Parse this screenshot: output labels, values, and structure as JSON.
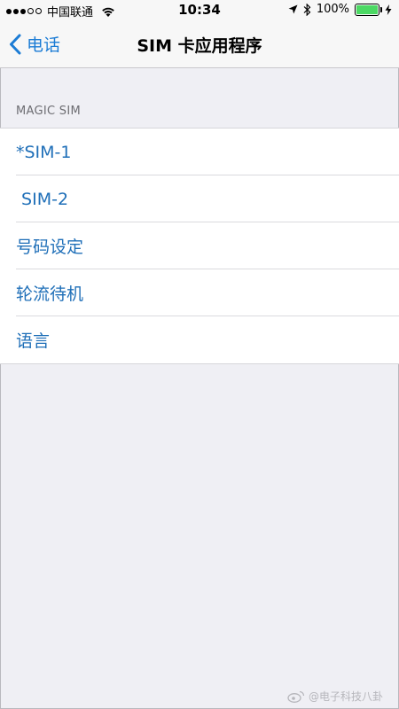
{
  "status_bar": {
    "carrier": "中国联通",
    "time": "10:34",
    "battery": "100%",
    "battery_level": 1.0,
    "signal_bars_filled": 3,
    "signal_bars_total": 5
  },
  "nav": {
    "back_label": "电话",
    "title": "SIM 卡应用程序"
  },
  "section": {
    "header": "MAGIC SIM"
  },
  "items": [
    {
      "label": "*SIM-1"
    },
    {
      "label": " SIM-2"
    },
    {
      "label": "号码设定"
    },
    {
      "label": "轮流待机"
    },
    {
      "label": "语言"
    }
  ],
  "watermark": {
    "text": "@电子科技八卦"
  },
  "colors": {
    "accent": "#1c7cd5",
    "row_text": "#1f6fb8",
    "background": "#efeff4",
    "battery": "#4cd964"
  }
}
